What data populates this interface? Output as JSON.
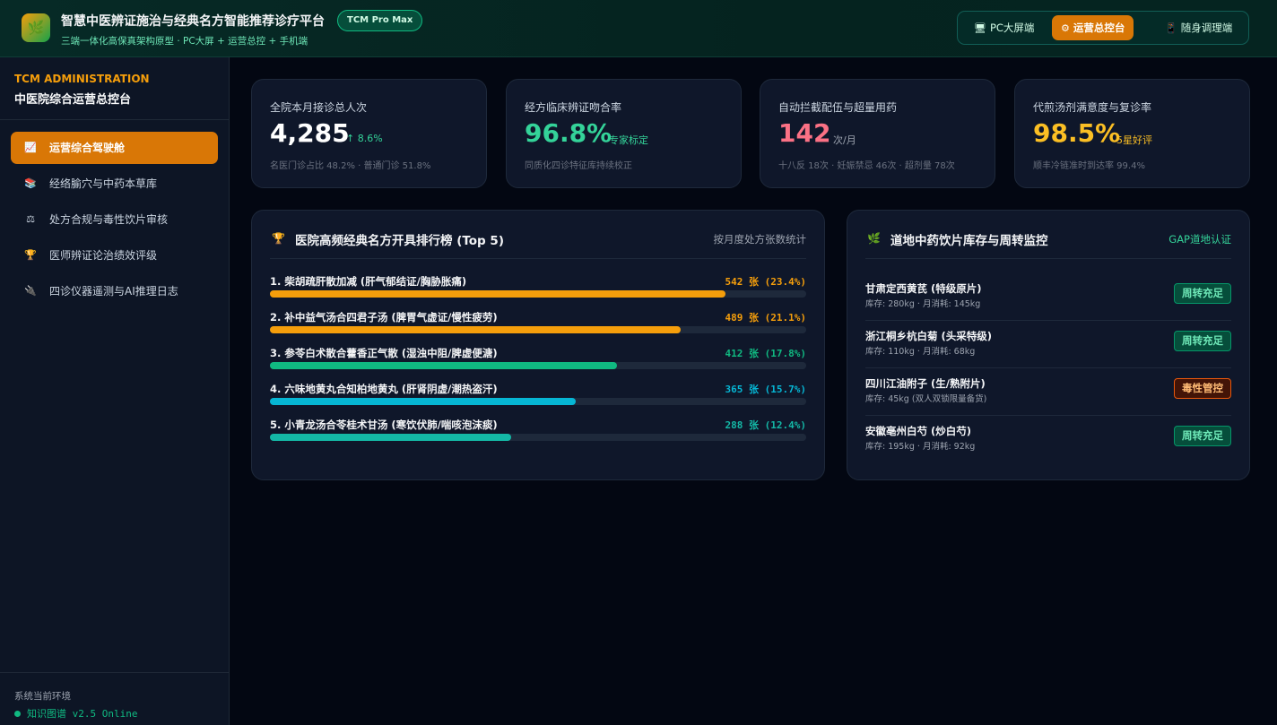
{
  "header": {
    "logo_icon": "herb-leaf-icon",
    "title": "智慧中医辨证施治与经典名方智能推荐诊疗平台",
    "badge": "TCM Pro Max",
    "subtitle": "三端一体化高保真架构原型 · PC大屏 + 运营总控 + 手机端",
    "tabs": [
      {
        "icon": "🖥",
        "label": "PC大屏端"
      },
      {
        "icon": "⚙",
        "label": "运营总控台",
        "active": true
      },
      {
        "icon": "📱",
        "label": "随身调理端"
      }
    ]
  },
  "sidebar": {
    "en_title": "TCM ADMINISTRATION",
    "cn_title": "中医院综合运营总控台",
    "items": [
      {
        "icon": "📈",
        "label": "运营综合驾驶舱",
        "active": true
      },
      {
        "icon": "📚",
        "label": "经络腧穴与中药本草库"
      },
      {
        "icon": "⚖",
        "label": "处方合规与毒性饮片审核"
      },
      {
        "icon": "🏆",
        "label": "医师辨证论治绩效评级"
      },
      {
        "icon": "🔌",
        "label": "四诊仪器遥测与AI推理日志"
      }
    ],
    "env_label": "系统当前环境",
    "env_value": "知识图谱 v2.5 Online"
  },
  "kpis": [
    {
      "label": "全院本月接诊总人次",
      "value": "4,285",
      "unit": "↑ 8.6%",
      "note": "名医门诊占比 48.2% · 普通门诊 51.8%",
      "value_color": "#ffffff",
      "unit_color": "#34d399"
    },
    {
      "label": "经方临床辨证吻合率",
      "value": "96.8%",
      "unit": "专家标定",
      "note": "同质化四诊特征库持续校正",
      "value_color": "#34d399",
      "unit_color": "#34d399"
    },
    {
      "label": "自动拦截配伍与超量用药",
      "value": "142",
      "unit": "次/月",
      "note": "十八反 18次 · 妊娠禁忌 46次 · 超剂量 78次",
      "value_color": "#fb7185",
      "unit_color": "#9ca3af"
    },
    {
      "label": "代煎汤剂满意度与复诊率",
      "value": "98.5%",
      "unit": "5星好评",
      "note": "顺丰冷链准时到达率 99.4%",
      "value_color": "#fbbf24",
      "unit_color": "#fbbf24"
    }
  ],
  "ranking": {
    "icon": "trophy-icon",
    "title": "医院高频经典名方开具排行榜 (Top 5)",
    "right_note": "按月度处方张数统计",
    "items": [
      {
        "name": "1. 柴胡疏肝散加减 (肝气郁结证/胸胁胀痛)",
        "value": "542 张 (23.4%)",
        "percent": 23.4,
        "color": "#f59e0b"
      },
      {
        "name": "2. 补中益气汤合四君子汤 (脾胃气虚证/慢性疲劳)",
        "value": "489 张 (21.1%)",
        "percent": 21.1,
        "color": "#f59e0b"
      },
      {
        "name": "3. 参苓白术散合藿香正气散 (湿浊中阻/脾虚便溏)",
        "value": "412 张 (17.8%)",
        "percent": 17.8,
        "color": "#10b981"
      },
      {
        "name": "4. 六味地黄丸合知柏地黄丸 (肝肾阴虚/潮热盗汗)",
        "value": "365 张 (15.7%)",
        "percent": 15.7,
        "color": "#06b6d4"
      },
      {
        "name": "5. 小青龙汤合苓桂术甘汤 (寒饮伏肺/喘咳泡沫痰)",
        "value": "288 张 (12.4%)",
        "percent": 12.4,
        "color": "#14b8a6"
      }
    ]
  },
  "inventory": {
    "icon": "herb-sprout-icon",
    "title": "道地中药饮片库存与周转监控",
    "right_note": "GAP道地认证",
    "items": [
      {
        "name": "甘肃定西黄芪 (特级原片)",
        "meta": "库存: 280kg · 月消耗: 145kg",
        "status": "周转充足",
        "level": "ok"
      },
      {
        "name": "浙江桐乡杭白菊 (头采特级)",
        "meta": "库存: 110kg · 月消耗: 68kg",
        "status": "周转充足",
        "level": "ok"
      },
      {
        "name": "四川江油附子 (生/熟附片)",
        "meta": "库存: 45kg (双人双锁限量备货)",
        "status": "毒性管控",
        "level": "warn"
      },
      {
        "name": "安徽亳州白芍 (炒白芍)",
        "meta": "库存: 195kg · 月消耗: 92kg",
        "status": "周转充足",
        "level": "ok"
      }
    ]
  }
}
